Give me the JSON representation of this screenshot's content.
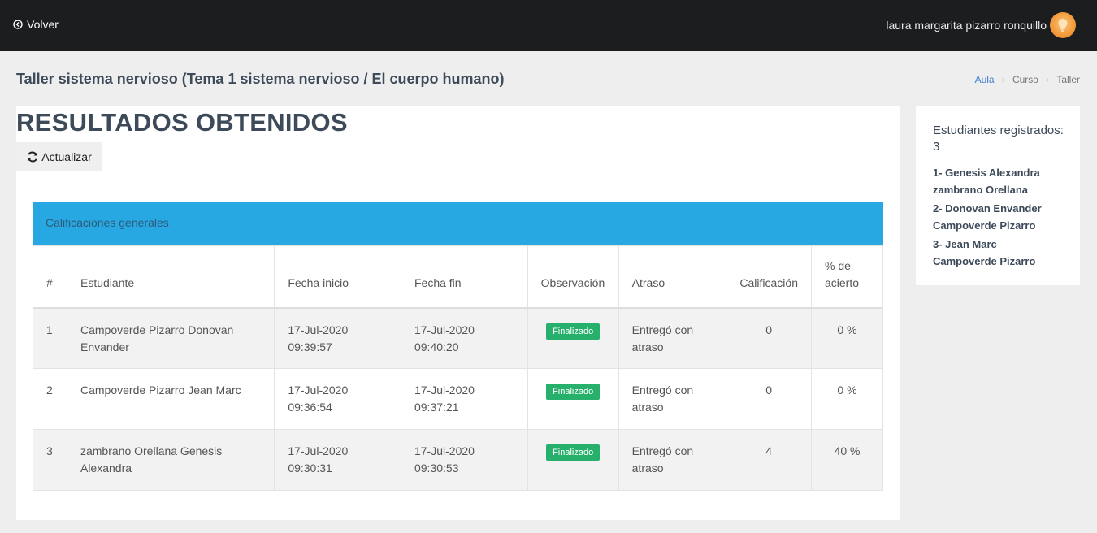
{
  "topbar": {
    "back_label": "Volver",
    "user_name": "laura margarita pizarro ronquillo"
  },
  "page": {
    "title": "Taller sistema nervioso (Tema 1 sistema nervioso / El cuerpo humano)"
  },
  "breadcrumb": [
    "Aula",
    "Curso",
    "Taller"
  ],
  "main": {
    "heading": "RESULTADOS OBTENIDOS",
    "refresh_label": "Actualizar",
    "grades_title": "Calificaciones generales",
    "columns": [
      "#",
      "Estudiante",
      "Fecha inicio",
      "Fecha fin",
      "Observación",
      "Atraso",
      "Calificación",
      "% de acierto"
    ],
    "rows": [
      {
        "n": "1",
        "student": "Campoverde Pizarro Donovan Envander",
        "start_date": "17-Jul-2020",
        "start_time": "09:39:57",
        "end_date": "17-Jul-2020",
        "end_time": "09:40:20",
        "status": "Finalizado",
        "delay": "Entregó con atraso",
        "grade": "0",
        "pct": "0 %"
      },
      {
        "n": "2",
        "student": "Campoverde Pizarro Jean Marc",
        "start_date": "17-Jul-2020",
        "start_time": "09:36:54",
        "end_date": "17-Jul-2020",
        "end_time": "09:37:21",
        "status": "Finalizado",
        "delay": "Entregó con atraso",
        "grade": "0",
        "pct": "0 %"
      },
      {
        "n": "3",
        "student": "zambrano Orellana Genesis Alexandra",
        "start_date": "17-Jul-2020",
        "start_time": "09:30:31",
        "end_date": "17-Jul-2020",
        "end_time": "09:30:53",
        "status": "Finalizado",
        "delay": "Entregó con atraso",
        "grade": "4",
        "pct": "40 %"
      }
    ]
  },
  "side": {
    "title": "Estudiantes registrados: 3",
    "students": [
      "1- Genesis Alexandra zambrano Orellana",
      "2- Donovan Envander Campoverde Pizarro",
      "3- Jean Marc Campoverde Pizarro"
    ]
  },
  "colors": {
    "topbar": "#1c1d1f",
    "grades_header": "#27a8e2",
    "badge": "#27b06b",
    "link": "#3f7fd1",
    "avatar": "#f39a3a"
  },
  "icons": {
    "back": "circle-arrow-left-icon",
    "refresh": "refresh-icon",
    "avatar": "lightbulb-avatar-icon"
  }
}
